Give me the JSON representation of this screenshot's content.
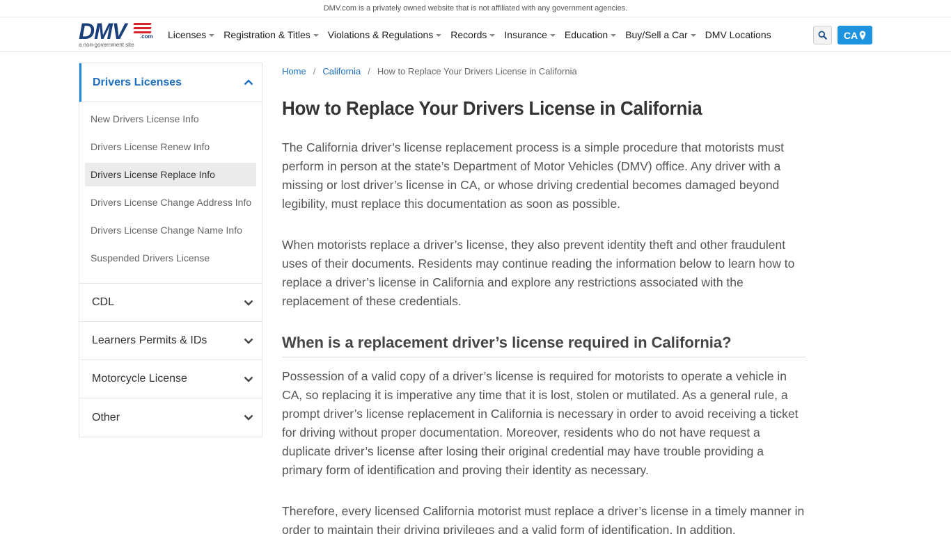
{
  "topbar": {
    "notice": "DMV.com is a privately owned website that is not affiliated with any government agencies."
  },
  "logo": {
    "text": "DMV",
    "suffix": ".com",
    "tagline": "a non-government site",
    "accent_color": "#d6242a",
    "brand_color": "#1b3f7a"
  },
  "nav": {
    "items": [
      {
        "label": "Licenses",
        "has_dropdown": true
      },
      {
        "label": "Registration & Titles",
        "has_dropdown": true
      },
      {
        "label": "Violations & Regulations",
        "has_dropdown": true
      },
      {
        "label": "Records",
        "has_dropdown": true
      },
      {
        "label": "Insurance",
        "has_dropdown": true
      },
      {
        "label": "Education",
        "has_dropdown": true
      },
      {
        "label": "Buy/Sell a Car",
        "has_dropdown": true
      },
      {
        "label": "DMV Locations",
        "has_dropdown": false
      }
    ],
    "search_icon": "search-icon",
    "state_label": "CA",
    "state_icon": "map-pin-icon",
    "state_color": "#1e93e0"
  },
  "sidebar": {
    "active_section": {
      "label": "Drivers Licenses",
      "items": [
        "New Drivers License Info",
        "Drivers License Renew Info",
        "Drivers License Replace Info",
        "Drivers License Change Address Info",
        "Drivers License Change Name Info",
        "Suspended Drivers License"
      ],
      "selected_index": 2
    },
    "sections": [
      "CDL",
      "Learners Permits & IDs",
      "Motorcycle License",
      "Other"
    ]
  },
  "breadcrumb": {
    "home": "Home",
    "state": "California",
    "current": "How to Replace Your Drivers License in California"
  },
  "article": {
    "title": "How to Replace Your Drivers License in California",
    "p1": "The California driver’s license replacement process is a simple procedure that motorists must perform in person at the state’s Department of Motor Vehicles (DMV) office. Any driver with a missing or lost driver’s license in CA, or whose driving credential becomes damaged beyond legibility, must replace this documentation as soon as possible.",
    "p2": "When motorists replace a driver’s license, they also prevent identity theft and other fraudulent uses of their documents. Residents may continue reading the information below to learn how to replace a driver’s license in California and explore any restrictions associated with the replacement of these credentials.",
    "h2": "When is a replacement driver’s license required in California?",
    "p3": "Possession of a valid copy of a driver’s license is required for motorists to operate a vehicle in CA, so replacing it is imperative any time that it is lost, stolen or mutilated. As a general rule, a prompt driver’s license replacement in California is necessary in order to avoid receiving a ticket for driving without proper documentation. Moreover, residents who do not have request a duplicate driver’s license after losing their original credential may have trouble providing a primary form of identification and proving their identity as necessary.",
    "p4": "Therefore, every licensed California motorist must replace a driver’s license in a timely manner in order to maintain their driving privileges and a valid form of identification. In addition,"
  }
}
